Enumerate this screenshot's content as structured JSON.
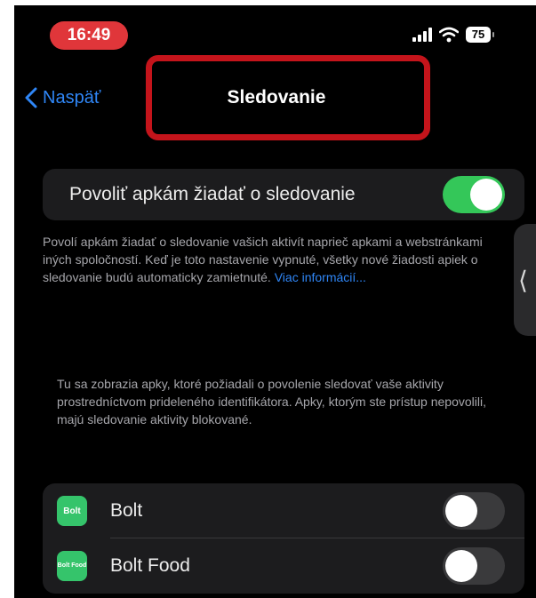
{
  "status_bar": {
    "time": "16:49",
    "battery": "75",
    "icons": [
      "cellular-signal-icon",
      "wifi-icon",
      "battery-icon"
    ]
  },
  "nav": {
    "back_label": "Naspäť",
    "title": "Sledovanie",
    "highlight_color": "#c4141b"
  },
  "tracking": {
    "label": "Povoliť apkám žiadať o sledovanie",
    "enabled": true,
    "description": "Povolí apkám žiadať o sledovanie vašich aktivít naprieč apkami a webstránkami iných spoločností. Keď je toto nastavenie vypnuté, všetky nové žiadosti apiek o sledovanie budú automaticky zamietnuté.",
    "more_info_link": "Viac informácií..."
  },
  "apps_note": "Tu sa zobrazia apky, ktoré požiadali o povolenie sledovať vaše aktivity prostredníctvom prideleného identifikátora. Apky, ktorým ste prístup nepovolili, majú sledovanie aktivity blokované.",
  "apps": [
    {
      "name": "Bolt",
      "icon_text": "Bolt",
      "enabled": false
    },
    {
      "name": "Bolt Food",
      "icon_text": "Bolt Food",
      "enabled": false
    }
  ],
  "colors": {
    "accent_blue": "#2f86f6",
    "toggle_on": "#34c759",
    "app_icon_green": "#35c46b",
    "time_pill_red": "#e0363a"
  }
}
